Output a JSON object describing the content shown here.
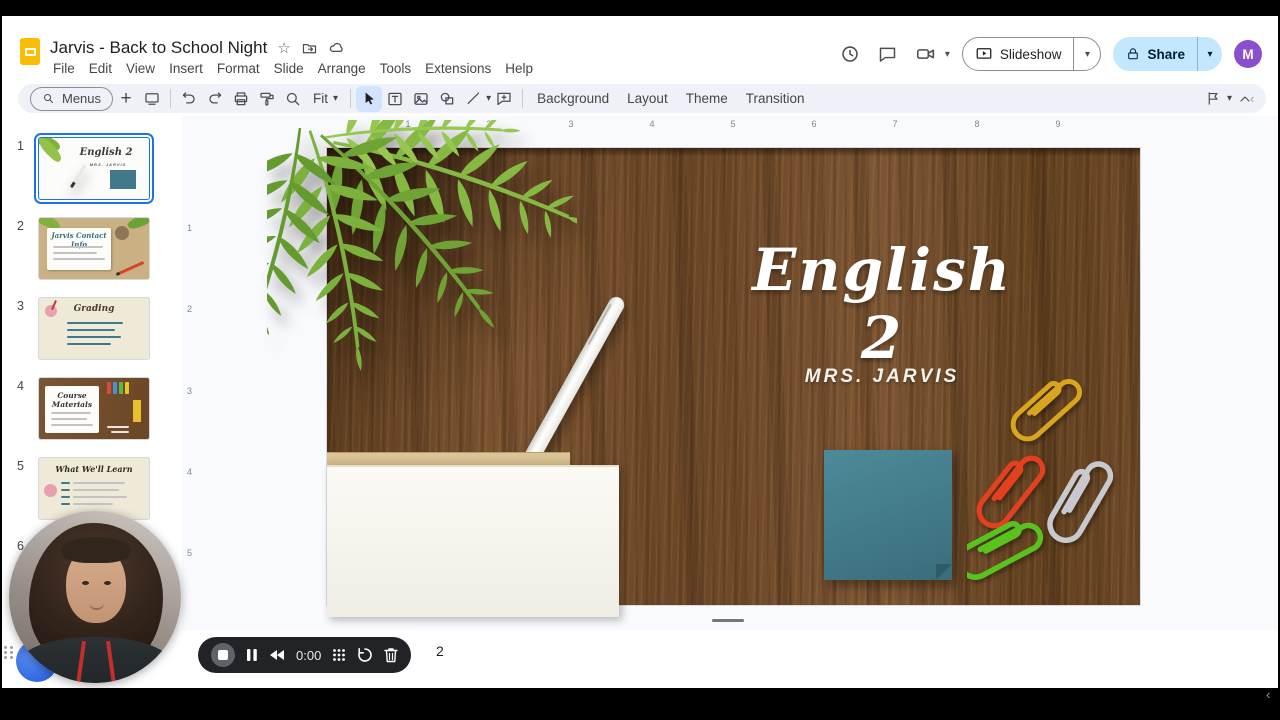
{
  "icons": {
    "star": "☆",
    "dropdown": "▾",
    "chevron_left": "‹",
    "plus": "+"
  },
  "chrome": {
    "doc_title": "Jarvis - Back to School Night",
    "menu_items": [
      "File",
      "Edit",
      "View",
      "Insert",
      "Format",
      "Slide",
      "Arrange",
      "Tools",
      "Extensions",
      "Help"
    ],
    "slideshow_label": "Slideshow",
    "share_label": "Share",
    "avatar_initial": "M"
  },
  "toolbar": {
    "menus_label": "Menus",
    "zoom_value": "Fit",
    "background_label": "Background",
    "layout_label": "Layout",
    "theme_label": "Theme",
    "transition_label": "Transition"
  },
  "filmstrip": {
    "slides": [
      {
        "num": "1",
        "title": "English 2",
        "subtitle": "MRS. JARVIS"
      },
      {
        "num": "2",
        "title": "Jarvis Contact Info"
      },
      {
        "num": "3",
        "title": "Grading"
      },
      {
        "num": "4",
        "title": "Course Materials"
      },
      {
        "num": "5",
        "title": "What We'll Learn"
      },
      {
        "num": "6",
        "title": ""
      }
    ]
  },
  "rulers": {
    "horizontal": [
      "1",
      "2",
      "3",
      "4",
      "5",
      "6",
      "7",
      "8",
      "9"
    ],
    "vertical": [
      "1",
      "2",
      "3",
      "4",
      "5"
    ]
  },
  "slide": {
    "title": "English 2",
    "subtitle": "MRS. JARVIS"
  },
  "recorder": {
    "time": "0:00"
  },
  "notes_text": "2",
  "colors": {
    "accent": "#1a73e8",
    "share_bg": "#c2e7ff",
    "wood": "#6b4726",
    "teal": "#41798a",
    "clip_gold": "#d8a51e",
    "clip_red": "#e2401f",
    "clip_silver": "#c7c9ce",
    "clip_green": "#59c21e",
    "record_bar": "#212327"
  }
}
